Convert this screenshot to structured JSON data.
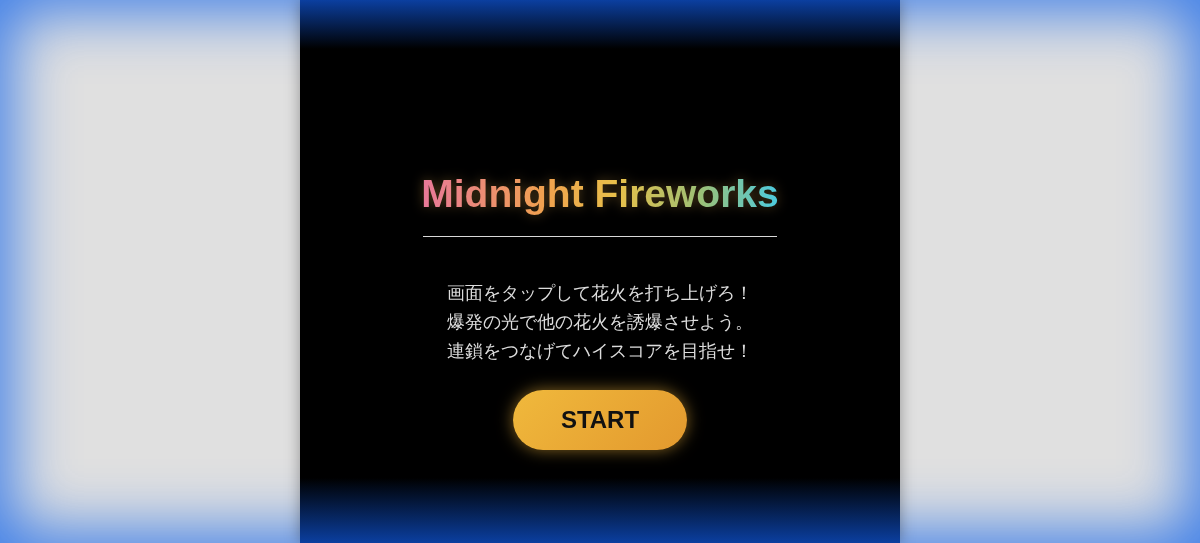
{
  "title": "Midnight Fireworks",
  "description": [
    "画面をタップして花火を打ち上げろ！",
    "爆発の光で他の花火を誘爆させよう。",
    "連鎖をつなげてハイスコアを目指せ！"
  ],
  "start_button": {
    "label": "START"
  }
}
